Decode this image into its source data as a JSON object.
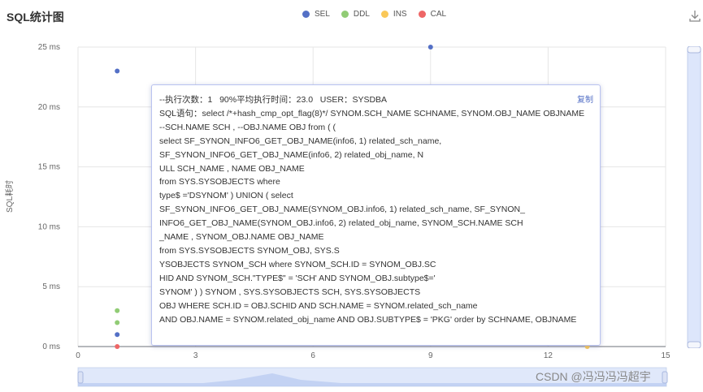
{
  "title": "SQL统计图",
  "download_icon": "download-icon",
  "legend": [
    {
      "label": "SEL",
      "color": "#5470c6"
    },
    {
      "label": "DDL",
      "color": "#91cc75"
    },
    {
      "label": "INS",
      "color": "#fac858"
    },
    {
      "label": "CAL",
      "color": "#ee6666"
    }
  ],
  "chart_data": {
    "type": "scatter",
    "ylabel": "SQL耗时",
    "xlim": [
      0,
      15
    ],
    "ylim": [
      0,
      25
    ],
    "x_ticks": [
      "0",
      "3",
      "6",
      "9",
      "12",
      "15"
    ],
    "y_ticks": [
      "0 ms",
      "5 ms",
      "10 ms",
      "15 ms",
      "20 ms",
      "25 ms"
    ],
    "grid": true,
    "legend_position": "top",
    "series": [
      {
        "name": "SEL",
        "color": "#5470c6",
        "points": [
          [
            1,
            23
          ],
          [
            1,
            1
          ],
          [
            9,
            25
          ]
        ]
      },
      {
        "name": "DDL",
        "color": "#91cc75",
        "points": [
          [
            1,
            3
          ],
          [
            1,
            2
          ]
        ]
      },
      {
        "name": "INS",
        "color": "#fac858",
        "points": [
          [
            13,
            0
          ]
        ]
      },
      {
        "name": "CAL",
        "color": "#ee6666",
        "points": [
          [
            1,
            0
          ]
        ]
      }
    ]
  },
  "tooltip": {
    "header": "--执行次数：1   90%平均执行时间：23.0   USER：SYSDBA",
    "copy_label": "复制",
    "sql_lines": [
      "SQL语句：select /*+hash_cmp_opt_flag(8)*/ SYNOM.SCH_NAME SCHNAME, SYNOM.OBJ_NAME OBJNAME",
      "--SCH.NAME SCH , --OBJ.NAME OBJ from ( (",
      "select SF_SYNON_INFO6_GET_OBJ_NAME(info6, 1) related_sch_name,",
      "SF_SYNON_INFO6_GET_OBJ_NAME(info6, 2) related_obj_name, N",
      "ULL SCH_NAME , NAME OBJ_NAME",
      "from SYS.SYSOBJECTS where",
      "type$ ='DSYNOM' ) UNION ( select",
      "SF_SYNON_INFO6_GET_OBJ_NAME(SYNOM_OBJ.info6, 1) related_sch_name, SF_SYNON_",
      "INFO6_GET_OBJ_NAME(SYNOM_OBJ.info6, 2) related_obj_name, SYNOM_SCH.NAME SCH",
      "_NAME , SYNOM_OBJ.NAME OBJ_NAME",
      "from SYS.SYSOBJECTS SYNOM_OBJ, SYS.S",
      "YSOBJECTS SYNOM_SCH where SYNOM_SCH.ID = SYNOM_OBJ.SC",
      "HID AND SYNOM_SCH.\"TYPE$\" = 'SCH' AND SYNOM_OBJ.subtype$='",
      "SYNOM' ) ) SYNOM , SYS.SYSOBJECTS SCH, SYS.SYSOBJECTS",
      "OBJ WHERE SCH.ID = OBJ.SCHID AND SCH.NAME = SYNOM.related_sch_name",
      "AND OBJ.NAME = SYNOM.related_obj_name AND OBJ.SUBTYPE$ = 'PKG' order by SCHNAME, OBJNAME"
    ]
  },
  "watermark": "CSDN @冯冯冯冯超宇"
}
